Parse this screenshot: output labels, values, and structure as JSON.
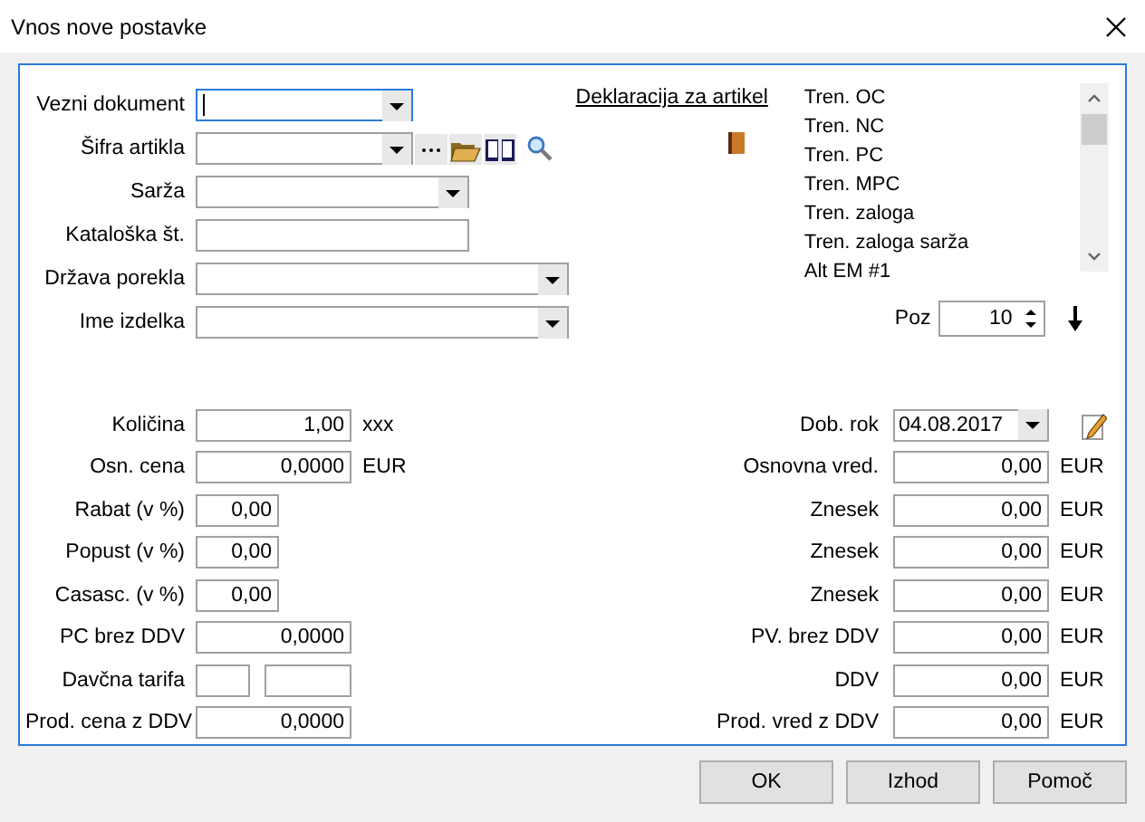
{
  "window": {
    "title": "Vnos nove postavke"
  },
  "top_fields": [
    {
      "label": "Vezni dokument",
      "kind": "combo",
      "focused": true
    },
    {
      "label": "Šifra artikla",
      "kind": "lookup",
      "focused": false
    },
    {
      "label": "Sarža",
      "kind": "combo",
      "focused": false
    },
    {
      "label": "Kataloška št.",
      "kind": "text",
      "focused": false
    },
    {
      "label": "Država porekla",
      "kind": "combo",
      "focused": false
    },
    {
      "label": "Ime izdelka",
      "kind": "combo",
      "focused": false
    }
  ],
  "declaration_link": "Deklaracija za artikel",
  "info_list": [
    "Tren. OC",
    "Tren. NC",
    "Tren. PC",
    "Tren. MPC",
    "Tren. zaloga",
    "Tren. zaloga sarža",
    "Alt EM #1"
  ],
  "position": {
    "label": "Poz",
    "value": "10"
  },
  "left_amounts": [
    {
      "label": "Količina",
      "kind": "wide",
      "value": "1,00",
      "unit": "xxx"
    },
    {
      "label": "Osn. cena",
      "kind": "wide",
      "value": "0,0000",
      "unit": "EUR"
    },
    {
      "label": "Rabat (v %)",
      "kind": "narrow",
      "value": "0,00"
    },
    {
      "label": "Popust (v %)",
      "kind": "narrow",
      "value": "0,00"
    },
    {
      "label": "Casasc. (v %)",
      "kind": "narrow",
      "value": "0,00"
    },
    {
      "label": "PC brez DDV",
      "kind": "wide",
      "value": "0,0000"
    },
    {
      "label": "Davčna tarifa",
      "kind": "pair"
    },
    {
      "label": "Prod. cena z DDV",
      "kind": "wide",
      "value": "0,0000"
    }
  ],
  "right_amounts": [
    {
      "label": "Dob. rok",
      "kind": "date",
      "value": "04.08.2017"
    },
    {
      "label": "Osnovna vred.",
      "kind": "amount",
      "value": "0,00",
      "unit": "EUR"
    },
    {
      "label": "Znesek",
      "kind": "amount",
      "value": "0,00",
      "unit": "EUR"
    },
    {
      "label": "Znesek",
      "kind": "amount",
      "value": "0,00",
      "unit": "EUR"
    },
    {
      "label": "Znesek",
      "kind": "amount",
      "value": "0,00",
      "unit": "EUR"
    },
    {
      "label": "PV. brez DDV",
      "kind": "amount",
      "value": "0,00",
      "unit": "EUR"
    },
    {
      "label": "DDV",
      "kind": "amount",
      "value": "0,00",
      "unit": "EUR"
    },
    {
      "label": "Prod. vred z DDV",
      "kind": "amount",
      "value": "0,00",
      "unit": "EUR"
    }
  ],
  "buttons": [
    "OK",
    "Izhod",
    "Pomoč"
  ]
}
